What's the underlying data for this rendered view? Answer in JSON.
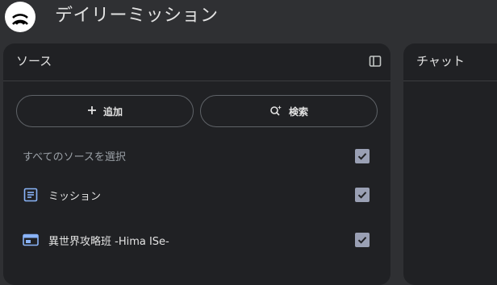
{
  "app": {
    "title": "デイリーミッション",
    "logo_icon": "notebook-logo-icon"
  },
  "sources_panel": {
    "title": "ソース",
    "toggle_icon": "panel-collapse-icon",
    "add_button": {
      "label": "追加",
      "icon": "plus-icon"
    },
    "search_button": {
      "label": "検索",
      "icon": "sparkle-search-icon"
    },
    "select_all": {
      "label": "すべてのソースを選択",
      "checked": true
    },
    "items": [
      {
        "label": "ミッション",
        "icon": "document-icon",
        "checked": true
      },
      {
        "label": "異世界攻略班 -Hima ISe-",
        "icon": "web-page-icon",
        "checked": true
      }
    ]
  },
  "chat_panel": {
    "title": "チャット"
  },
  "colors": {
    "background": "#2f3033",
    "panel": "#202124",
    "accent_blue": "#8ab4f8",
    "checkbox": "#9aa0b4"
  }
}
